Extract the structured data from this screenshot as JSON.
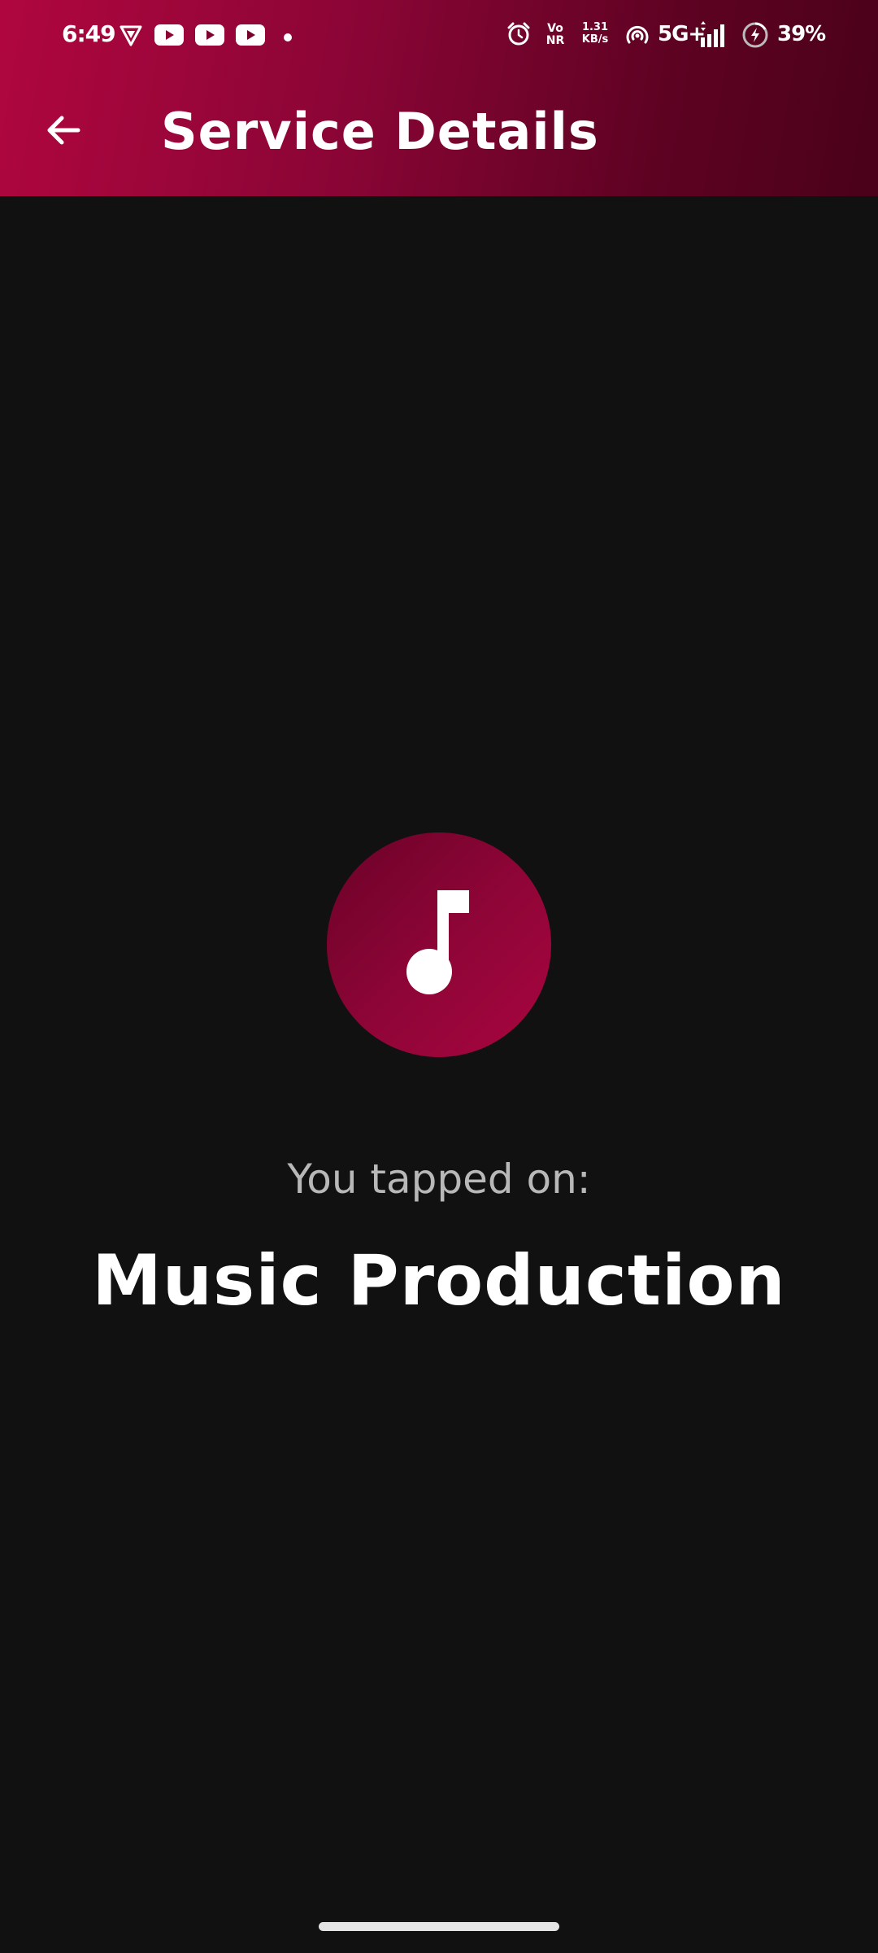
{
  "status_bar": {
    "time": "6:49",
    "left_icons": [
      "vpn-shield-icon",
      "youtube-icon",
      "youtube-icon",
      "youtube-icon",
      "notification-dot-icon"
    ],
    "volte_line1": "Vo",
    "volte_line2": "NR",
    "net_speed_value": "1.31",
    "net_speed_unit": "KB/s",
    "network_type": "5G+",
    "battery_percent": "39%",
    "right_icons": [
      "alarm-icon",
      "hotspot-icon",
      "signal-icon",
      "battery-charging-icon"
    ]
  },
  "app_bar": {
    "title": "Service Details",
    "back_icon": "arrow-left-icon"
  },
  "main": {
    "icon": "music-note-icon",
    "tapped_label": "You tapped on:",
    "service_name": "Music Production"
  },
  "colors": {
    "header_gradient_start": "#b0063f",
    "header_gradient_end": "#4a0119",
    "background": "#111111",
    "accent": "#900537"
  }
}
